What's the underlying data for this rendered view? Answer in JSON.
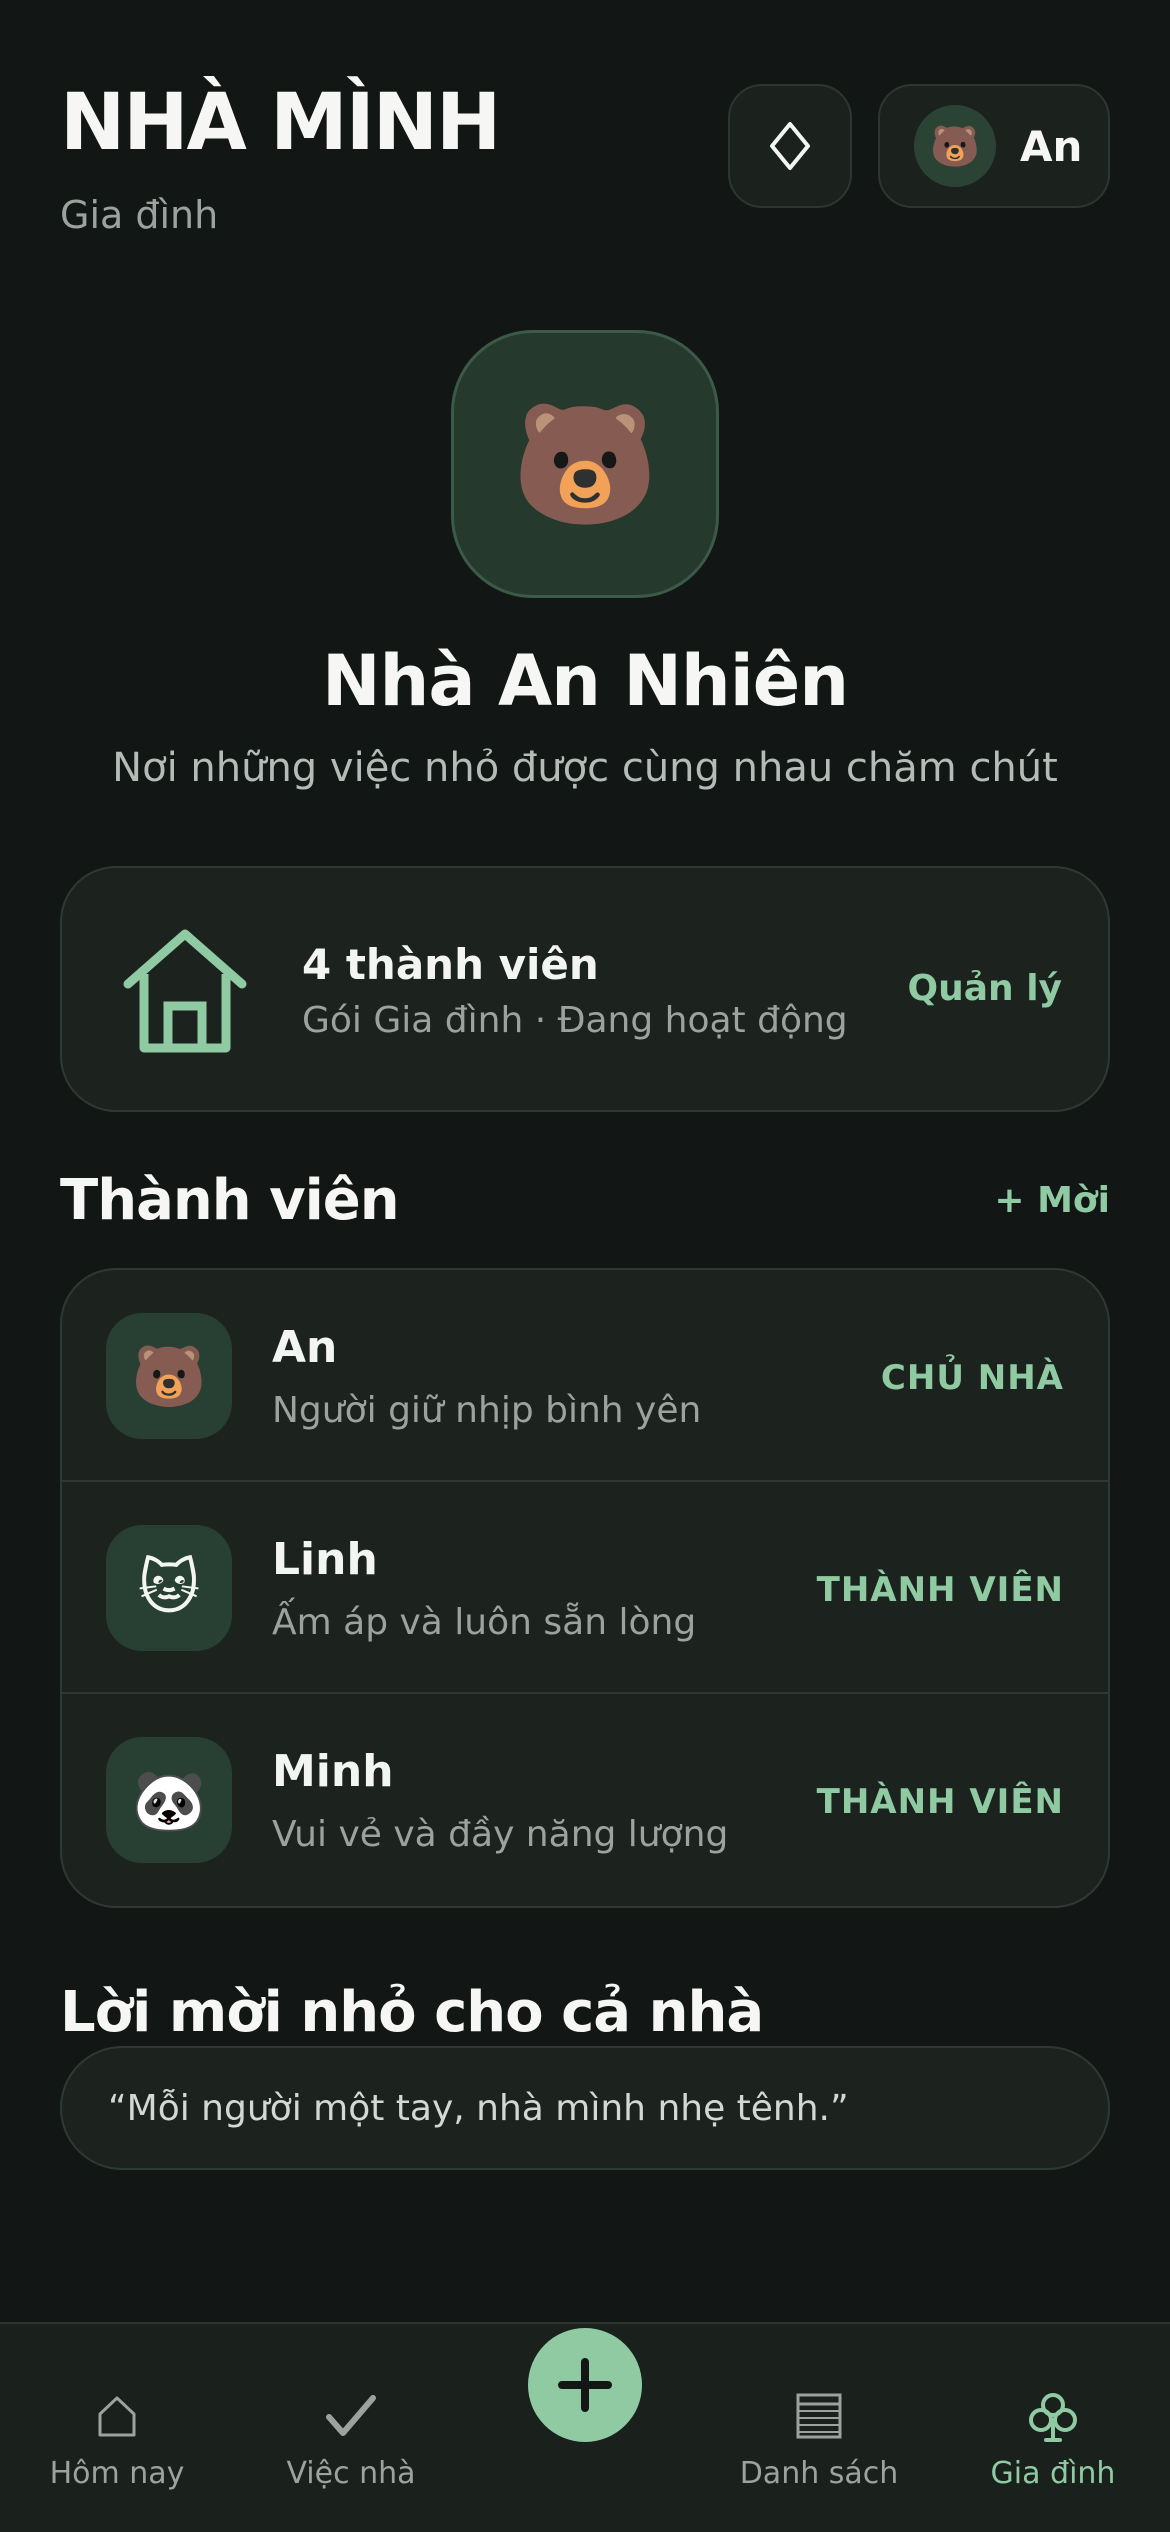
{
  "header": {
    "title": "NHÀ MÌNH",
    "subtitle": "Gia đình",
    "profile": {
      "name": "An",
      "avatar_emoji": "🐻"
    },
    "diamond_icon": "diamond-icon"
  },
  "hero": {
    "avatar_emoji": "🐻",
    "home_name": "Nhà An Nhiên",
    "tagline": "Nơi những việc nhỏ được cùng nhau chăm chút"
  },
  "plan_card": {
    "icon": "house-icon",
    "title": "4 thành viên",
    "subtitle": "Gói Gia đình · Đang hoạt động",
    "action": "Quản lý"
  },
  "members": {
    "title": "Thành viên",
    "invite": "+ Mời",
    "items": [
      {
        "emoji": "🐻",
        "name": "An",
        "desc": "Người giữ nhịp bình yên",
        "role": "CHỦ NHÀ"
      },
      {
        "emoji": "🐱",
        "name": "Linh",
        "desc": "Ấm áp và luôn sẵn lòng",
        "role": "THÀNH VIÊN"
      },
      {
        "emoji": "🐼",
        "name": "Minh",
        "desc": "Vui vẻ và đầy năng lượng",
        "role": "THÀNH VIÊN"
      }
    ]
  },
  "invite_section": {
    "title": "Lời mời nhỏ cho cả nhà",
    "quote": "“Mỗi người một tay, nhà mình nhẹ tênh.”"
  },
  "tabbar": {
    "tabs": [
      {
        "label": "Hôm nay",
        "icon": "home-icon"
      },
      {
        "label": "Việc nhà",
        "icon": "checkmark-icon"
      },
      {
        "label": "Danh sách",
        "icon": "list-icon"
      },
      {
        "label": "Gia đình",
        "icon": "clover-icon",
        "active": true
      }
    ],
    "fab_icon": "plus-icon"
  },
  "colors": {
    "background": "#121614",
    "accent": "#8fcaa3",
    "card": "#1c231f"
  }
}
